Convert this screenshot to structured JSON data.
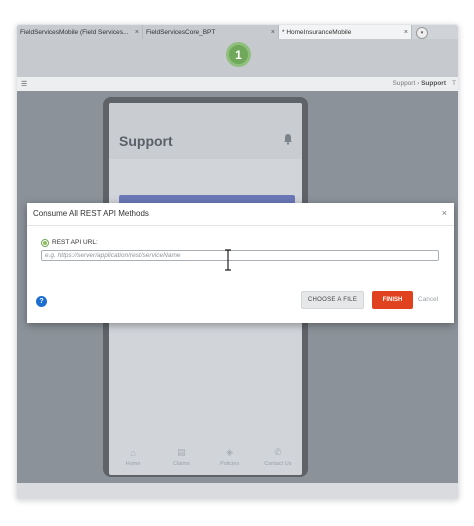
{
  "tabs": [
    {
      "label": "FieldServicesMobile (Field Services...",
      "close": "×"
    },
    {
      "label": "FieldServicesCore_BPT",
      "close": "×"
    },
    {
      "label": "* HomeInsuranceMobile",
      "close": "×"
    }
  ],
  "tab_dropdown": "▾",
  "step": {
    "number": "1"
  },
  "breadcrumb": {
    "parent": "Support",
    "separator": "›",
    "current": "Support",
    "edge": "T"
  },
  "phone": {
    "title": "Support",
    "nav": [
      {
        "label": "Home",
        "icon": "home-icon"
      },
      {
        "label": "Claims",
        "icon": "document-icon"
      },
      {
        "label": "Policies",
        "icon": "shield-icon"
      },
      {
        "label": "Contact Us",
        "icon": "phone-icon"
      }
    ]
  },
  "dialog": {
    "title": "Consume All REST API Methods",
    "close": "×",
    "radio_label": "REST API URL:",
    "url_value": "",
    "url_placeholder": "e.g. https://server/application/rest/serviceName",
    "help": "?",
    "choose_file_label": "CHOOSE A FILE",
    "finish_label": "FINISH",
    "cancel_label": "Cancel"
  },
  "colors": {
    "accent": "#e0421f",
    "step_green": "#6fa85a",
    "help_blue": "#1c6fd1",
    "banner": "#6b78b8"
  }
}
